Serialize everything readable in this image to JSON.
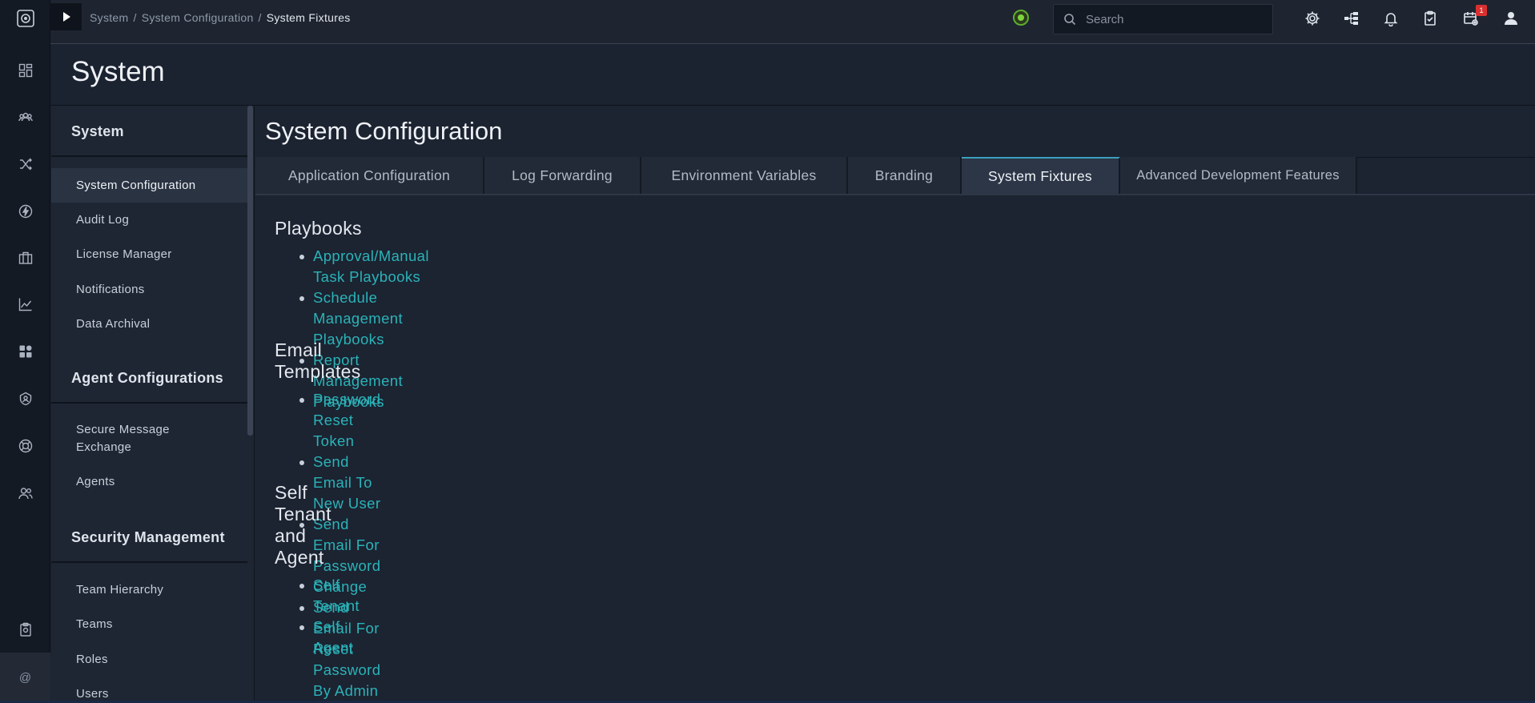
{
  "topbar": {
    "breadcrumb": [
      "System",
      "System Configuration",
      "System Fixtures"
    ],
    "search_placeholder": "Search",
    "notification_badge": "1",
    "status_color": "#7ed43c"
  },
  "rail": {
    "icons": [
      "dashboard-icon",
      "people-icon",
      "shuffle-icon",
      "bolt-icon",
      "briefcase-icon",
      "chart-icon",
      "grid-icon",
      "shield-icon",
      "lifebuoy-icon",
      "users-icon",
      "clipboard-icon"
    ],
    "bottom_symbol": "@"
  },
  "page": {
    "title": "System"
  },
  "sidenav": {
    "sections": [
      {
        "title": "System",
        "items": [
          "System Configuration",
          "Audit Log",
          "License Manager",
          "Notifications",
          "Data Archival"
        ]
      },
      {
        "title": "Agent Configurations",
        "items": [
          "Secure Message Exchange",
          "Agents"
        ]
      },
      {
        "title": "Security Management",
        "items": [
          "Team Hierarchy",
          "Teams",
          "Roles",
          "Users"
        ]
      }
    ],
    "active_item": "System Configuration"
  },
  "main": {
    "title": "System Configuration",
    "tabs": [
      {
        "label": "Application Configuration"
      },
      {
        "label": "Log Forwarding"
      },
      {
        "label": "Environment Variables"
      },
      {
        "label": "Branding"
      },
      {
        "label": "System Fixtures"
      },
      {
        "label": "Advanced Development Features"
      }
    ],
    "active_tab": "System Fixtures",
    "groups": [
      {
        "title": "Playbooks",
        "links": [
          "Approval/Manual Task Playbooks",
          "Schedule Management Playbooks",
          "Report Management Playbooks"
        ]
      },
      {
        "title": "Email Templates",
        "links": [
          "Password Reset Token",
          "Send Email To New User",
          "Send Email For Password Change",
          "Send Email For Reset Password By Admin"
        ]
      },
      {
        "title": "Self Tenant and Agent",
        "links": [
          "Self Tenant",
          "Self Agent"
        ]
      }
    ]
  },
  "colors": {
    "accent": "#3a9fbd",
    "link": "#2ab3b8",
    "badge": "#d9302f"
  }
}
